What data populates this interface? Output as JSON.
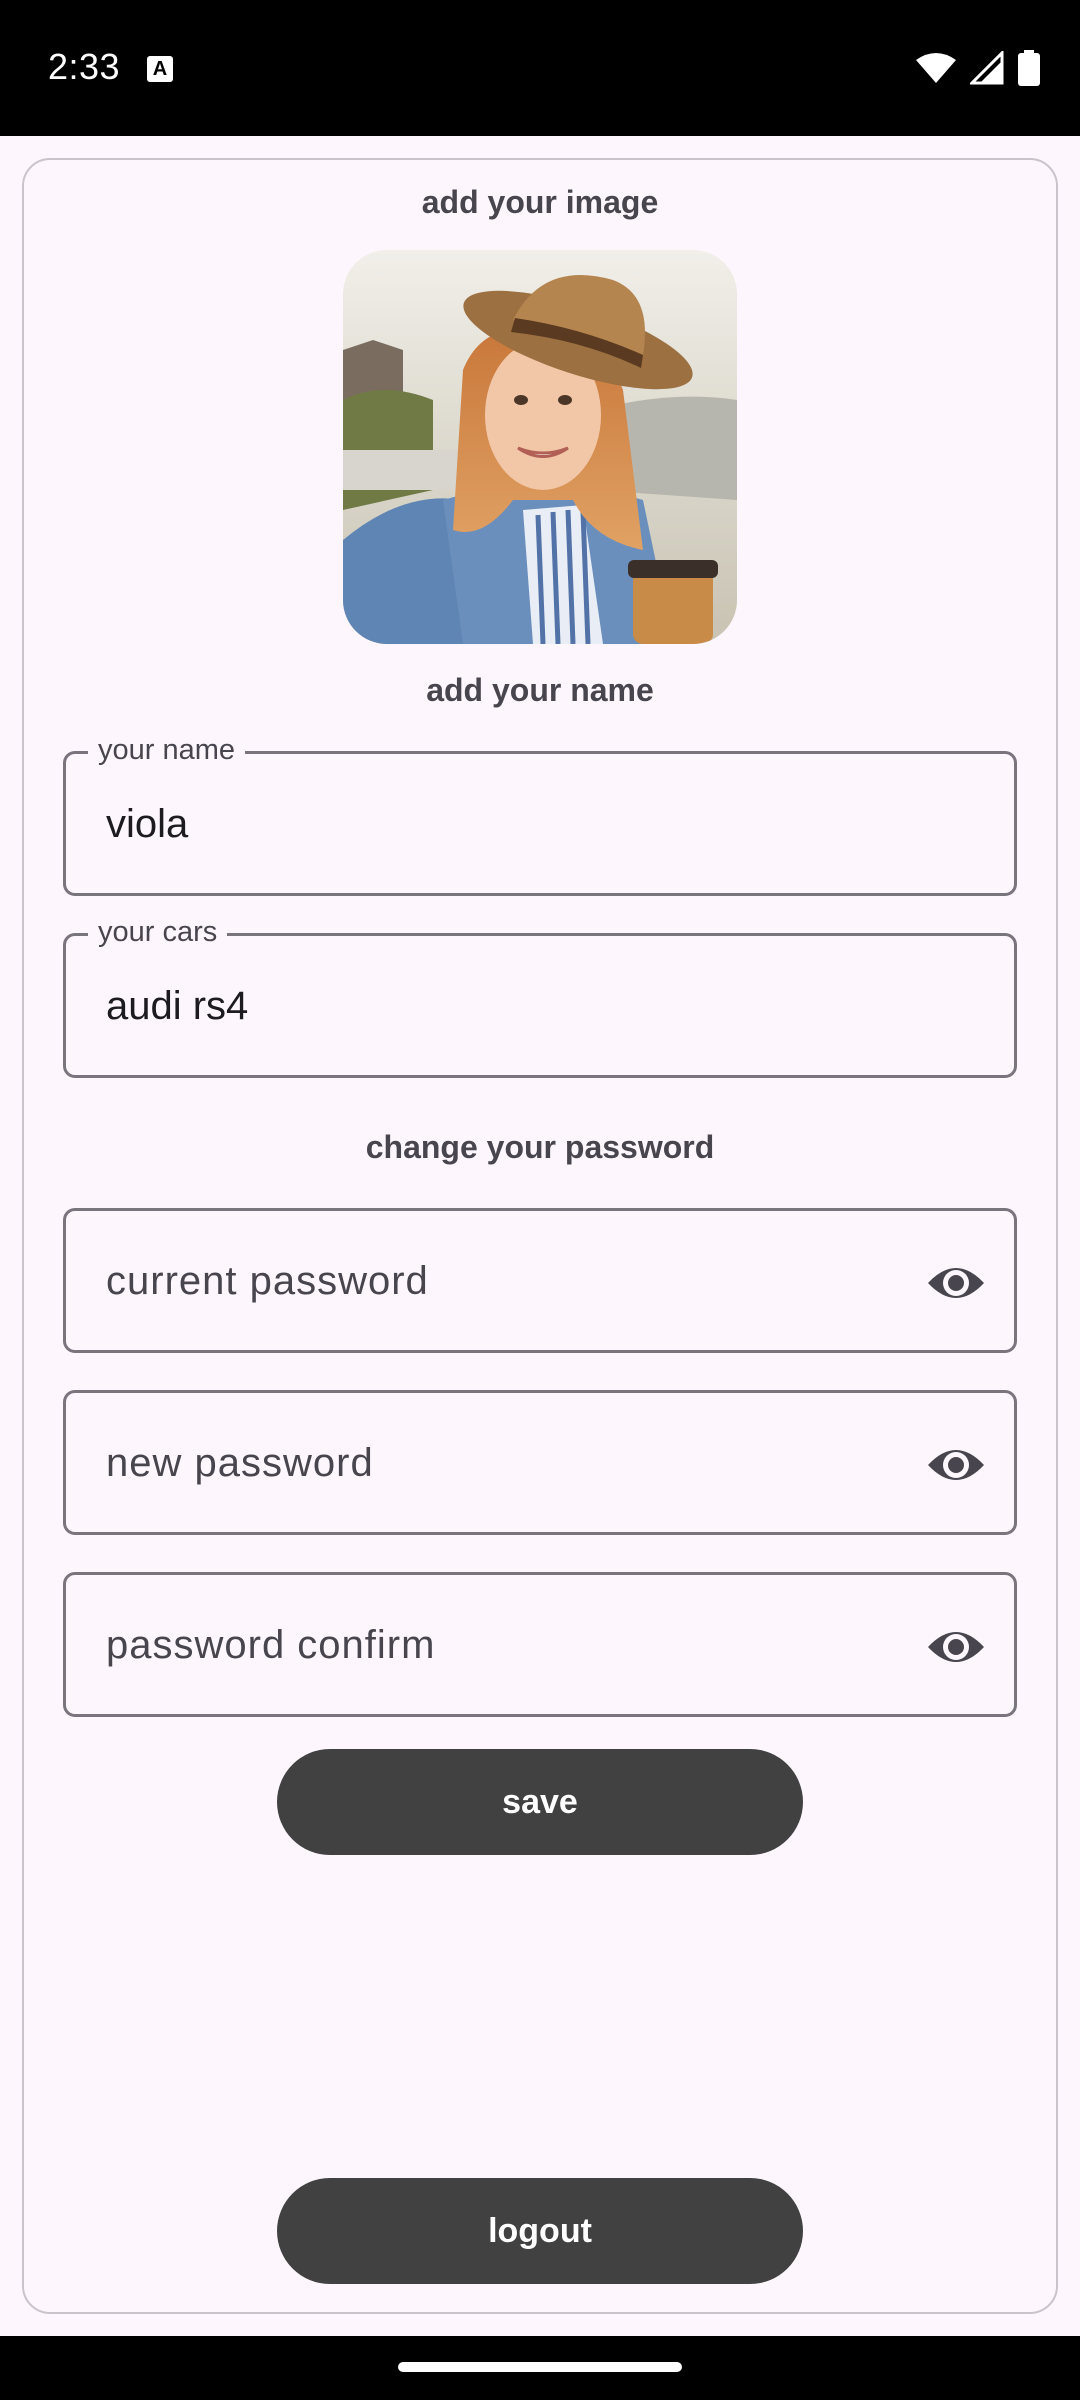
{
  "status_bar": {
    "time": "2:33",
    "notification_icon": "a-icon",
    "icons": [
      "wifi-icon",
      "signal-icon",
      "battery-icon"
    ]
  },
  "profile": {
    "image_title": "add your image",
    "name_title": "add your name",
    "name_field": {
      "label": "your name",
      "value": "viola"
    },
    "cars_field": {
      "label": "your cars",
      "value": "audi rs4"
    },
    "password_title": "change your password",
    "current_password": {
      "placeholder": "current password",
      "icon": "eye-icon"
    },
    "new_password": {
      "placeholder": "new password",
      "icon": "eye-icon"
    },
    "confirm_password": {
      "placeholder": "password confirm",
      "icon": "eye-icon"
    },
    "save_label": "save",
    "logout_label": "logout"
  },
  "colors": {
    "background": "#fdf7fd",
    "button": "#414141",
    "outline": "#79747e"
  }
}
